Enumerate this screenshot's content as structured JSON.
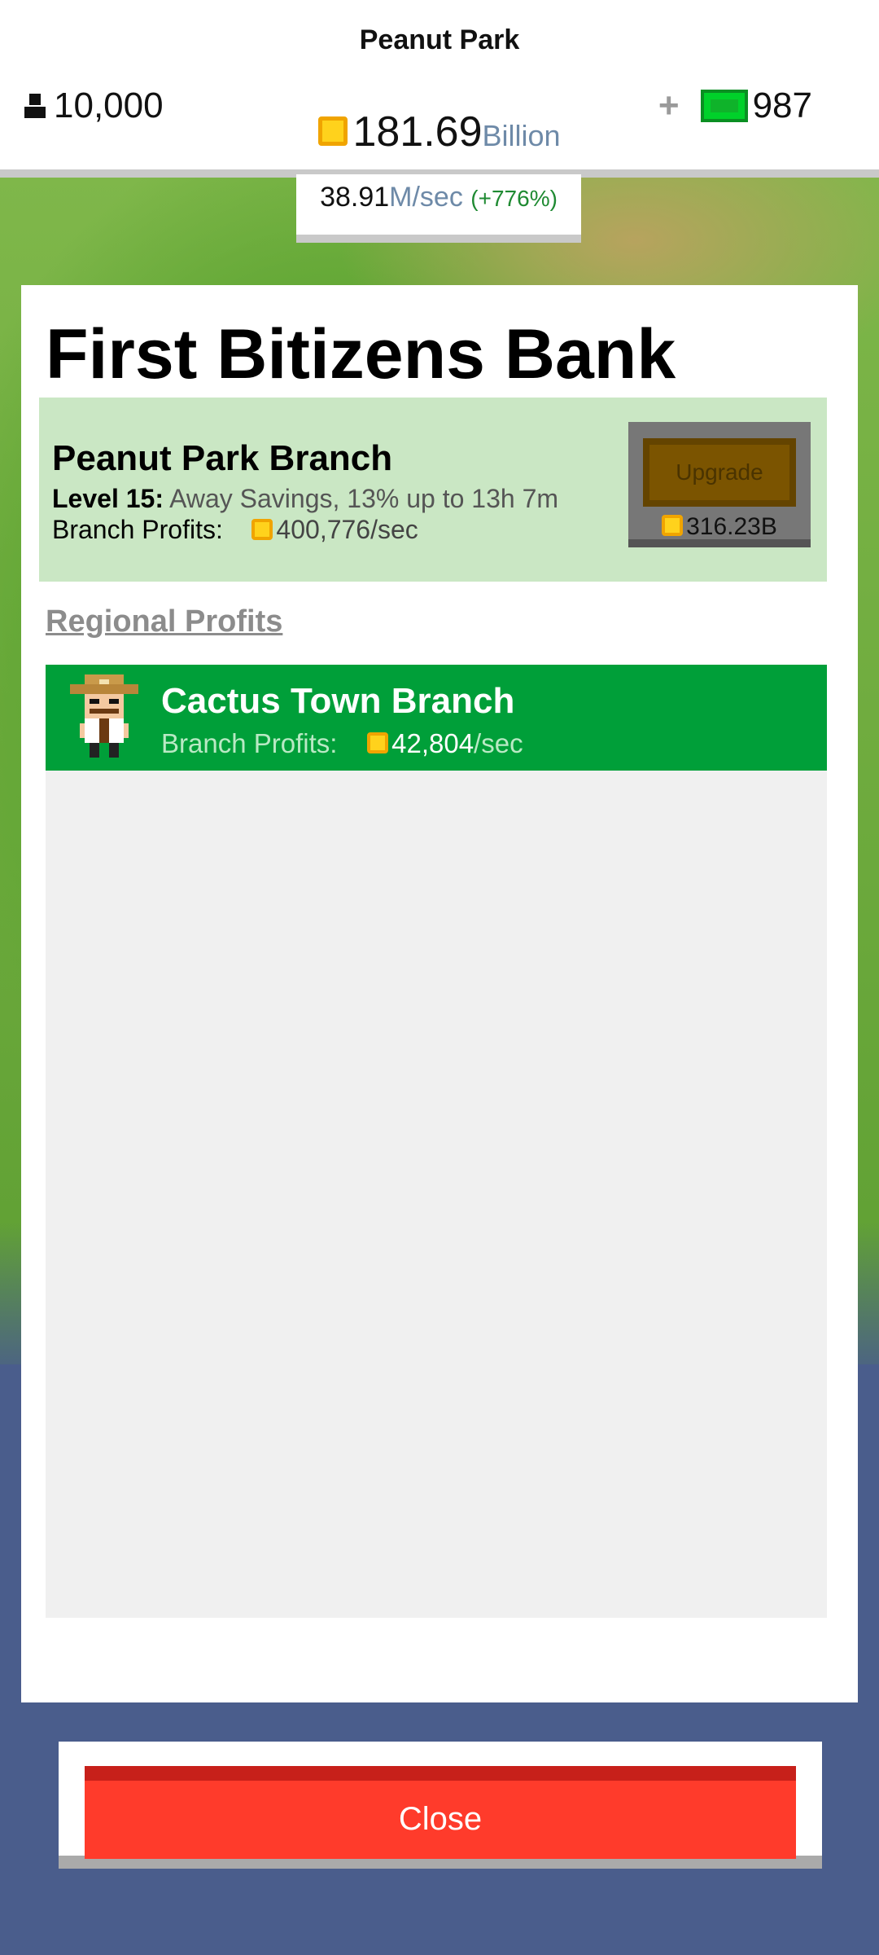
{
  "header": {
    "park_name": "Peanut Park",
    "population": "10,000",
    "money_value": "181.69",
    "money_unit": "Billion",
    "gems_plus": "+",
    "gems": "987",
    "rate_value": "38.91",
    "rate_unit": "M/sec",
    "rate_bonus": "(+776%)"
  },
  "panel": {
    "title": "First Bitizens Bank",
    "branch": {
      "name": "Peanut Park Branch",
      "level_label": "Level 15:",
      "level_desc": "Away Savings, 13% up to 13h 7m",
      "profit_label": "Branch Profits:",
      "profit_value": "400,776/sec",
      "upgrade_label": "Upgrade",
      "upgrade_cost": "316.23B"
    },
    "regional_heading": "Regional Profits",
    "regional_items": [
      {
        "name": "Cactus Town Branch",
        "profit_label": "Branch Profits:",
        "profit_value": "42,804",
        "profit_unit": "/sec"
      }
    ]
  },
  "footer": {
    "close_label": "Close"
  },
  "colors": {
    "accent_green": "#009f39",
    "close_red": "#ff3b2b",
    "coin": "#ffd21c"
  }
}
